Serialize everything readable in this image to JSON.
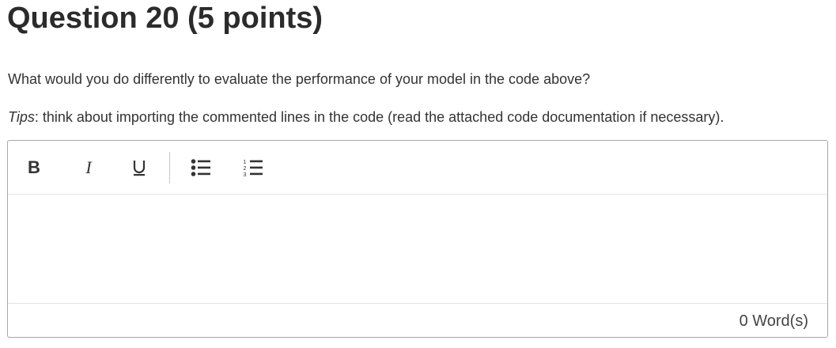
{
  "question": {
    "title": "Question 20 (5 points)",
    "prompt": "What would you do differently to evaluate the performance of your model in the code above?",
    "tips_label": "Tips",
    "tips_text": ": think about importing the commented lines in the code (read the attached code documentation if necessary)."
  },
  "editor": {
    "toolbar": {
      "bold_label": "B",
      "italic_label": "I",
      "underline_icon": "underline-icon",
      "bullet_list_icon": "bullet-list-icon",
      "numbered_list_icon": "numbered-list-icon"
    },
    "content": "",
    "word_count": "0 Word(s)"
  },
  "colors": {
    "text": "#333333",
    "border": "#a8a8a8",
    "divider": "#e3e3e3"
  }
}
